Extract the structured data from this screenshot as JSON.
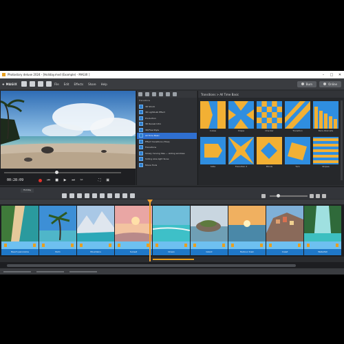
{
  "window": {
    "title": "Photostory deluxe 2024 - [Holiday.mvd (Example) - MAGIX ]",
    "controls": [
      "–",
      "□",
      "✕"
    ]
  },
  "menubar": {
    "brand": "❖ MAGIX",
    "menus": [
      "File",
      "Edit",
      "Effects",
      "Share",
      "Help"
    ],
    "buttons": [
      {
        "label": "Burn",
        "icon": "disc-icon"
      },
      {
        "label": "Online",
        "icon": "share-icon"
      }
    ]
  },
  "preview": {
    "timecode": "00:28:09"
  },
  "media_list": {
    "items": [
      {
        "label": "Transitions",
        "header": true
      },
      {
        "label": "3D Shock",
        "selected": false
      },
      {
        "label": "3D Lightbulb Effect",
        "selected": false
      },
      {
        "label": "Production",
        "selected": false
      },
      {
        "label": "3D Reveal Intro",
        "selected": false
      },
      {
        "label": "3D/Free Style",
        "selected": false
      },
      {
        "label": "All Time Basic",
        "selected": true
      },
      {
        "label": "Effect transitions (Tiles)",
        "selected": false
      },
      {
        "label": "Transitions",
        "selected": false
      },
      {
        "label": "Slowly moving tiles — sliding windows",
        "selected": false
      },
      {
        "label": "Sliding slow-light faces",
        "selected": false
      },
      {
        "label": "Movie Tools",
        "selected": false
      }
    ]
  },
  "transitions": {
    "header": "Transitions > All Time Basic",
    "items": [
      {
        "label": "Cubes",
        "icon": "cubes-icon"
      },
      {
        "label": "Shape",
        "icon": "shape-icon"
      },
      {
        "label": "Checker",
        "icon": "checker-icon"
      },
      {
        "label": "Transition",
        "icon": "diagonal-icon"
      },
      {
        "label": "Bars Alternate",
        "icon": "bars-icon"
      },
      {
        "label": "Slide",
        "icon": "slide-icon"
      },
      {
        "label": "Transition 2",
        "icon": "star-icon"
      },
      {
        "label": "Blinds",
        "icon": "diamond-icon"
      },
      {
        "label": "Turn",
        "icon": "turn-icon"
      },
      {
        "label": "Stripes",
        "icon": "stripes-icon"
      }
    ]
  },
  "timeline": {
    "project_tab": "Holiday",
    "clips": [
      {
        "label": "Beach panorama",
        "scene": "aerial-beach"
      },
      {
        "label": "Palm",
        "scene": "palm"
      },
      {
        "label": "Mountains",
        "scene": "mountains"
      },
      {
        "label": "Sunset",
        "scene": "pink-sunset"
      },
      {
        "label": "Ocean",
        "scene": "turquoise"
      },
      {
        "label": "Island",
        "scene": "rocky-island"
      },
      {
        "label": "Harbour town",
        "scene": "sunset-sea"
      },
      {
        "label": "Coast",
        "scene": "coast-town"
      },
      {
        "label": "Waterfall",
        "scene": "waterfall"
      }
    ]
  },
  "colors": {
    "accent": "#f0a030",
    "selection": "#2f6fd0",
    "transition_yellow": "#f2b034",
    "transition_blue": "#2f8ee0"
  }
}
